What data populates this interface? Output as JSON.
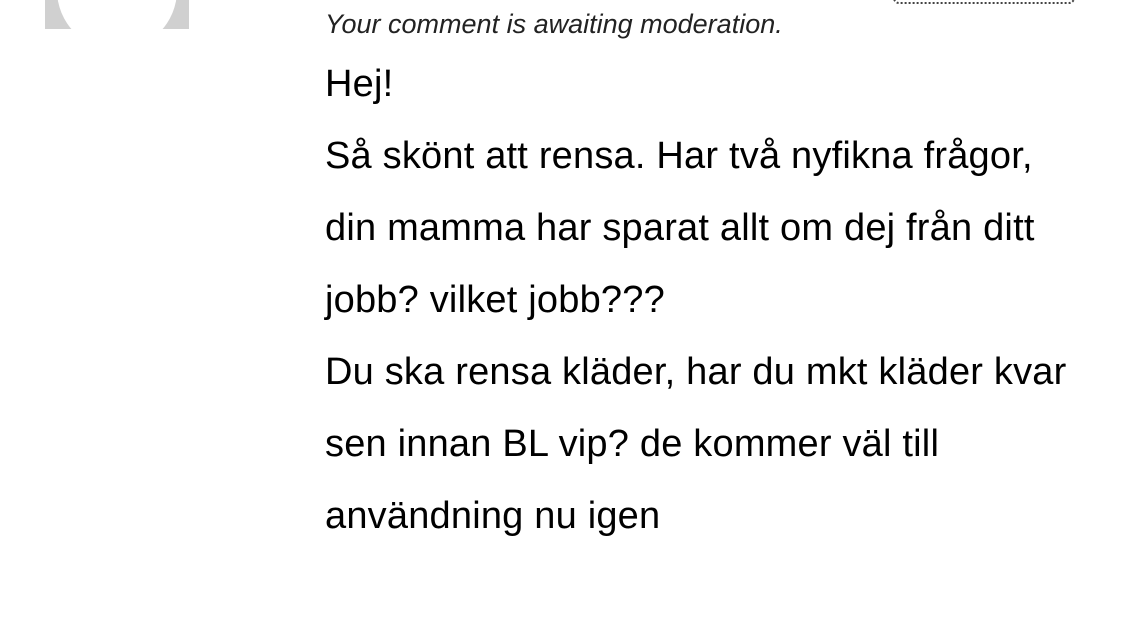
{
  "comment": {
    "moderation_notice": "Your comment is awaiting moderation.",
    "greeting": "Hej!",
    "paragraph_1": "Så skönt att rensa. Har två nyfikna frågor, din mamma har sparat allt om dej från ditt jobb? vilket jobb???",
    "paragraph_2": "Du ska rensa kläder, har du mkt kläder kvar sen innan BL vip? de kommer väl till användning nu igen"
  },
  "colors": {
    "avatar_background": "#d0d0d0",
    "text": "#000000",
    "moderation_text": "#222222"
  },
  "icons": {
    "avatar": "default-avatar-icon"
  }
}
